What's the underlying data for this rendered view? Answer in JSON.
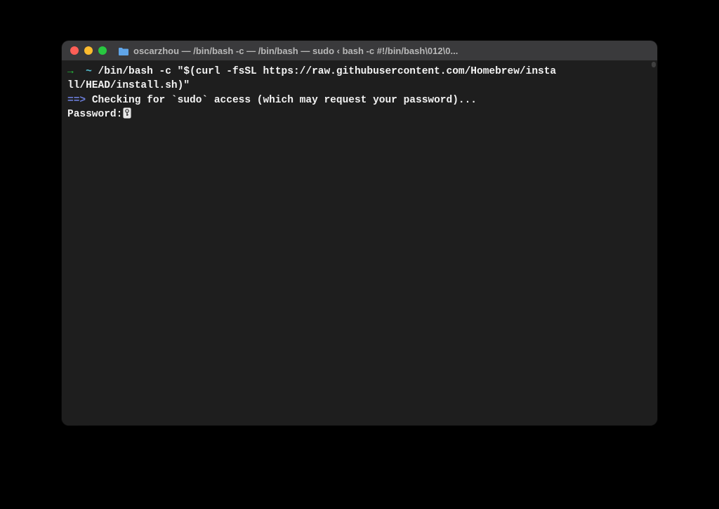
{
  "window": {
    "title": "oscarzhou — /bin/bash -c  — /bin/bash — sudo ‹ bash -c #!/bin/bash\\012\\0..."
  },
  "terminal": {
    "prompt_arrow": "→",
    "prompt_location": "~",
    "command_line1": "/bin/bash -c \"$(curl -fsSL https://raw.githubusercontent.com/Homebrew/insta",
    "command_line2": "ll/HEAD/install.sh)\"",
    "status_arrow": "==>",
    "status_message": "Checking for `sudo` access (which may request your password)...",
    "password_prompt": "Password:"
  },
  "colors": {
    "bg": "#000000",
    "terminal_bg": "#1e1e1e",
    "titlebar_bg": "#3a3a3c",
    "text": "#f2f2f2",
    "green": "#27c93f",
    "cyan": "#56c2d6",
    "blue": "#6b7dd8",
    "close": "#ff5f57",
    "minimize": "#febc2e",
    "maximize": "#28c840"
  }
}
